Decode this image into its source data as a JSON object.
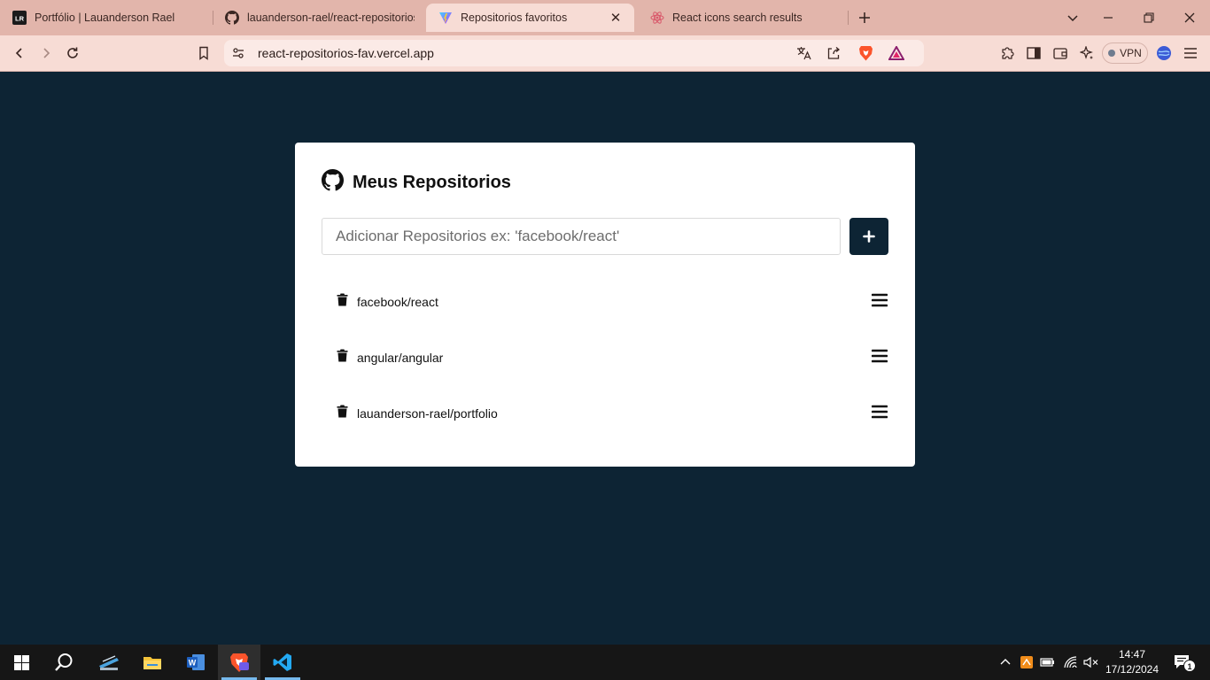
{
  "browser": {
    "tabs": [
      {
        "title": "Portfólio | Lauanderson Rael",
        "icon": "lr-logo-icon",
        "active": false
      },
      {
        "title": "lauanderson-rael/react-repositorios",
        "icon": "github-icon",
        "active": false
      },
      {
        "title": "Repositorios favoritos",
        "icon": "vite-icon",
        "active": true
      },
      {
        "title": "React icons search results",
        "icon": "react-icon",
        "active": false
      }
    ],
    "url": "react-repositorios-fav.vercel.app",
    "vpn_label": "VPN",
    "colors": {
      "tab_strip": "#e2b5ab",
      "toolbar": "#f7dcd5"
    }
  },
  "page": {
    "title": "Meus Repositorios",
    "input_placeholder": "Adicionar Repositorios ex: 'facebook/react'",
    "add_button_icon": "plus-icon",
    "repositories": [
      {
        "name": "facebook/react"
      },
      {
        "name": "angular/angular"
      },
      {
        "name": "lauanderson-rael/portfolio"
      }
    ],
    "colors": {
      "background": "#0d2434",
      "card": "#ffffff",
      "button": "#0d2434"
    }
  },
  "taskbar": {
    "apps": [
      "windows-start-icon",
      "search-icon",
      "scanner-icon",
      "file-explorer-icon",
      "word-icon",
      "brave-icon",
      "vscode-icon"
    ],
    "time": "14:47",
    "date": "17/12/2024",
    "notification_count": "1"
  }
}
